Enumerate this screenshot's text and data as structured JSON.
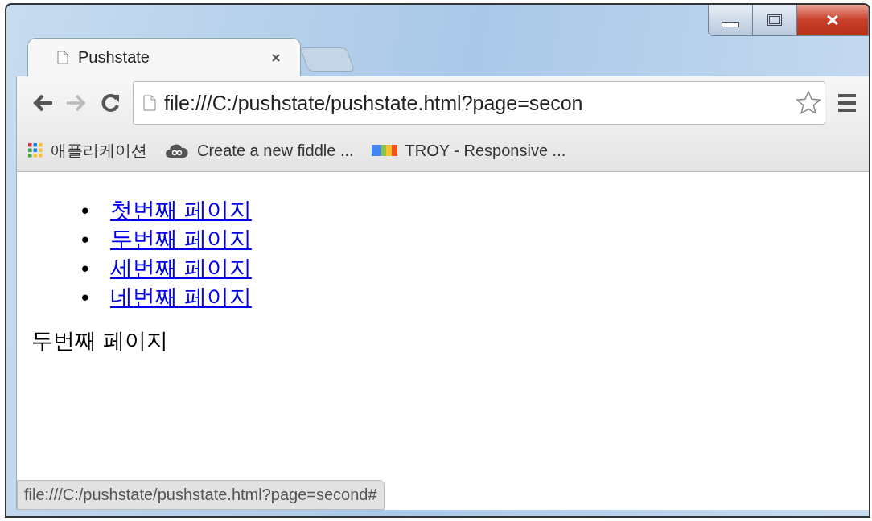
{
  "tabs": [
    {
      "title": "Pushstate",
      "selected": true
    }
  ],
  "address_bar": {
    "value": "file:///C:/pushstate/pushstate.html?page=secon",
    "bookmarked": false
  },
  "bookmarks": [
    {
      "kind": "apps",
      "label": "애플리케이션"
    },
    {
      "kind": "cloud",
      "label": "Create a new fiddle ..."
    },
    {
      "kind": "bars",
      "label": "TROY - Responsive ..."
    }
  ],
  "page": {
    "links": [
      {
        "bullet": "•",
        "label": "첫번째 페이지"
      },
      {
        "bullet": "•",
        "label": "두번째 페이지"
      },
      {
        "bullet": "•",
        "label": "세번째 페이지"
      },
      {
        "bullet": "•",
        "label": "네번째 페이지"
      }
    ],
    "text": "두번째 페이지"
  },
  "status_bar": "file:///C:/pushstate/pushstate.html?page=second#"
}
